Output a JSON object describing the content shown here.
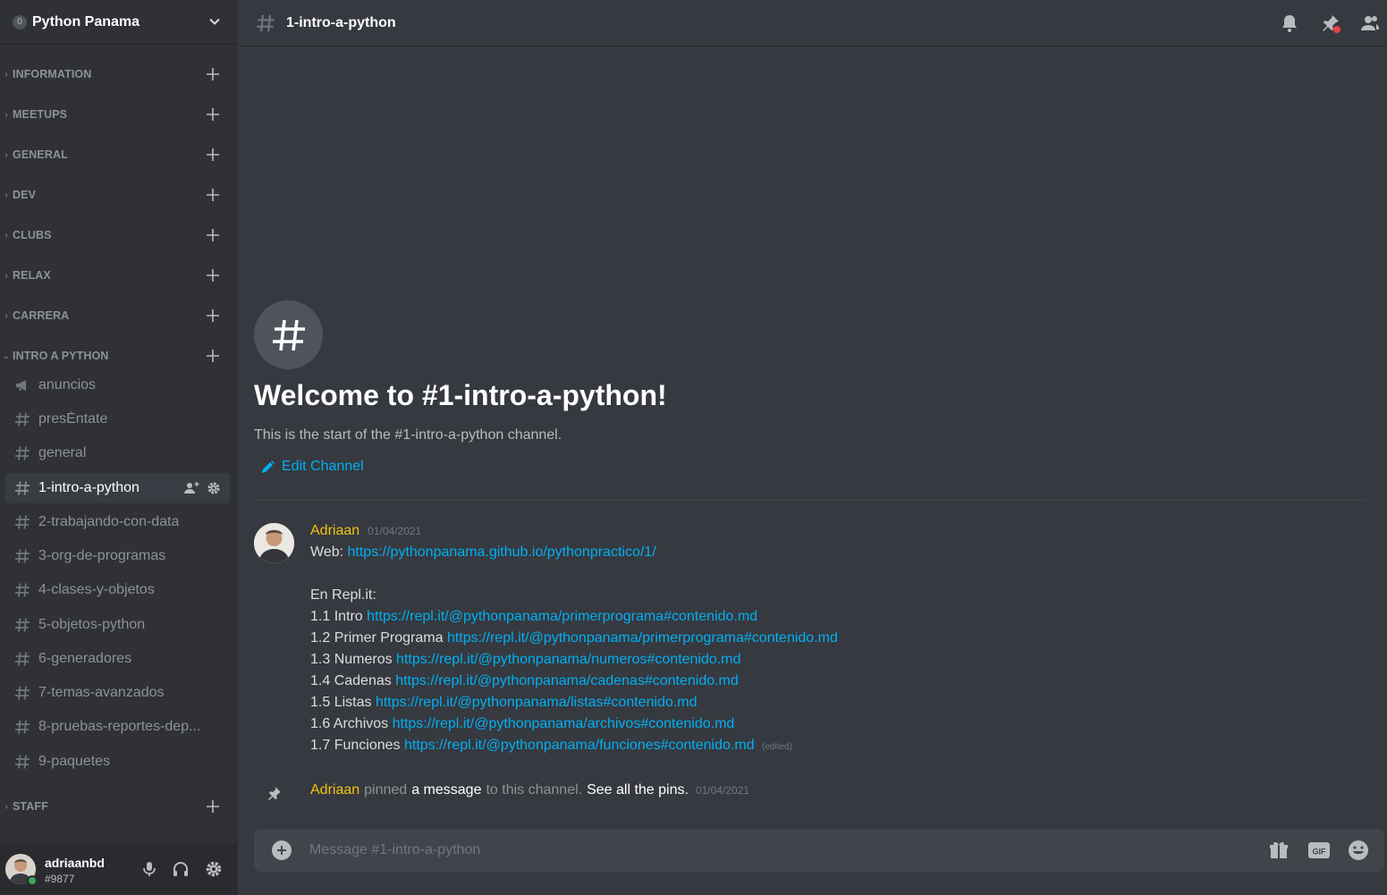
{
  "server": {
    "name": "Python Panama",
    "boost_glyph": "0"
  },
  "categories": [
    {
      "label": "INFORMATION",
      "collapsed": true
    },
    {
      "label": "MEETUPS",
      "collapsed": true
    },
    {
      "label": "GENERAL",
      "collapsed": true
    },
    {
      "label": "DEV",
      "collapsed": true
    },
    {
      "label": "CLUBS",
      "collapsed": true
    },
    {
      "label": "RELAX",
      "collapsed": true
    },
    {
      "label": "CARRERA",
      "collapsed": true
    },
    {
      "label": "INTRO A PYTHON",
      "collapsed": false
    },
    {
      "label": "STAFF",
      "collapsed": true
    }
  ],
  "channels": [
    {
      "label": "anuncios",
      "icon": "megaphone-icon"
    },
    {
      "label": "presÉntate",
      "icon": "hash-icon"
    },
    {
      "label": "general",
      "icon": "hash-icon"
    },
    {
      "label": "1-intro-a-python",
      "icon": "hash-icon",
      "selected": true
    },
    {
      "label": "2-trabajando-con-data",
      "icon": "hash-icon"
    },
    {
      "label": "3-org-de-programas",
      "icon": "hash-icon"
    },
    {
      "label": "4-clases-y-objetos",
      "icon": "hash-icon"
    },
    {
      "label": "5-objetos-python",
      "icon": "hash-icon"
    },
    {
      "label": "6-generadores",
      "icon": "hash-icon"
    },
    {
      "label": "7-temas-avanzados",
      "icon": "hash-icon"
    },
    {
      "label": "8-pruebas-reportes-dep...",
      "icon": "hash-icon"
    },
    {
      "label": "9-paquetes",
      "icon": "hash-icon"
    }
  ],
  "user": {
    "name": "adriaanbd",
    "tag": "#9877",
    "status": "online"
  },
  "topbar": {
    "channel": "1-intro-a-python"
  },
  "welcome": {
    "title": "Welcome to #1-intro-a-python!",
    "subtitle": "This is the start of the #1-intro-a-python channel.",
    "edit_label": "Edit Channel"
  },
  "message": {
    "author": "Adriaan",
    "time": "01/04/2021",
    "web_label": "Web:",
    "web_url": "https://pythonpanama.github.io/pythonpractico/1/",
    "repl_heading": "En Repl.it:",
    "items": [
      {
        "label": "1.1 Intro",
        "url": "https://repl.it/@pythonpanama/primerprograma#contenido.md"
      },
      {
        "label": "1.2 Primer Programa",
        "url": "https://repl.it/@pythonpanama/primerprograma#contenido.md"
      },
      {
        "label": "1.3 Numeros",
        "url": "https://repl.it/@pythonpanama/numeros#contenido.md"
      },
      {
        "label": "1.4 Cadenas",
        "url": "https://repl.it/@pythonpanama/cadenas#contenido.md"
      },
      {
        "label": "1.5 Listas",
        "url": "https://repl.it/@pythonpanama/listas#contenido.md"
      },
      {
        "label": "1.6 Archivos",
        "url": "https://repl.it/@pythonpanama/archivos#contenido.md"
      },
      {
        "label": "1.7 Funciones",
        "url": "https://repl.it/@pythonpanama/funciones#contenido.md"
      }
    ],
    "edited": "(edited)"
  },
  "pin_notice": {
    "author": "Adriaan",
    "verb": "pinned",
    "link": "a message",
    "rest": "to this channel.",
    "see_pins": "See all the pins.",
    "time": "01/04/2021"
  },
  "composer": {
    "placeholder": "Message #1-intro-a-python"
  },
  "colors": {
    "accent_link": "#00b0f4",
    "author": "#f1c40f",
    "online": "#3ba55d",
    "unread_dot": "#ed4245"
  }
}
